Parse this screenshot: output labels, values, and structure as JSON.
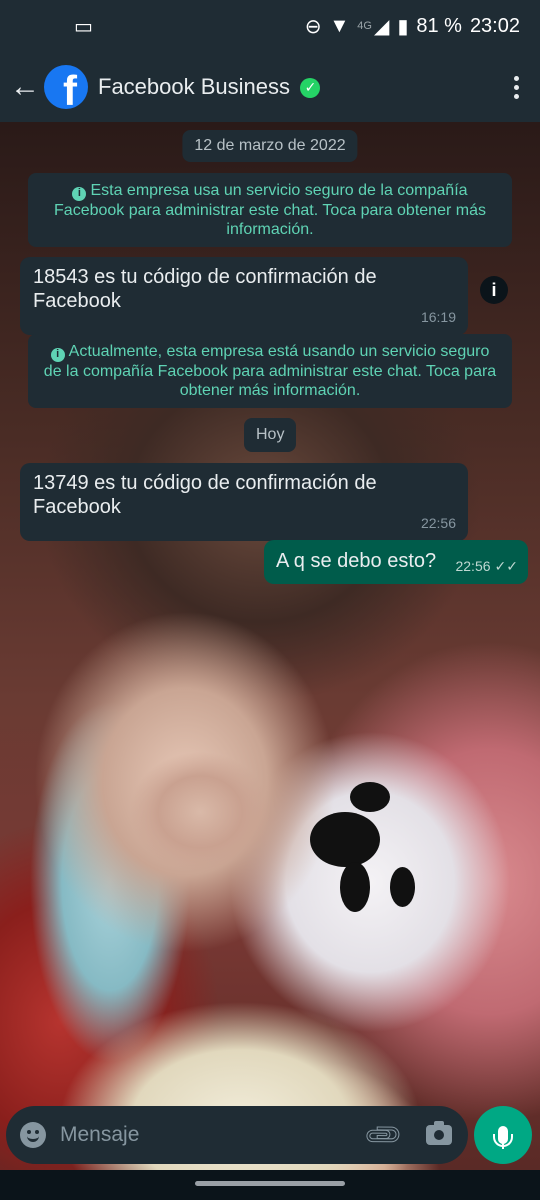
{
  "status_bar": {
    "notification_icon": "card-icon",
    "network": "4G",
    "battery": "81 %",
    "time": "23:02"
  },
  "header": {
    "contact_name": "Facebook Business",
    "verified_icon": "verified-check-icon",
    "back_icon": "arrow-left-icon",
    "menu_icon": "more-vertical-icon",
    "avatar_letter": "f"
  },
  "chat": {
    "date_divider": "12 de marzo de 2022",
    "system_messages": [
      "Esta empresa usa un servicio seguro de la compañía Facebook para administrar este chat. Toca para obtener más información.",
      "Actualmente, esta empresa está usando un servicio seguro de la compañía Facebook para administrar este chat. Toca para obtener más información."
    ],
    "today_divider": "Hoy",
    "messages": [
      {
        "direction": "in",
        "text": "18543 es tu código de confirmación de Facebook",
        "time": "16:19"
      },
      {
        "direction": "in",
        "text": "13749 es tu código de confirmación de Facebook",
        "time": "22:56"
      },
      {
        "direction": "out",
        "text": "A q se debo esto?",
        "time": "22:56",
        "status": "read"
      }
    ]
  },
  "composer": {
    "placeholder": "Mensaje"
  },
  "colors": {
    "bar": "#1f2c34",
    "outgoing_bubble": "#005c4b",
    "accent": "#00a884",
    "system_text": "#5fd3b4"
  }
}
